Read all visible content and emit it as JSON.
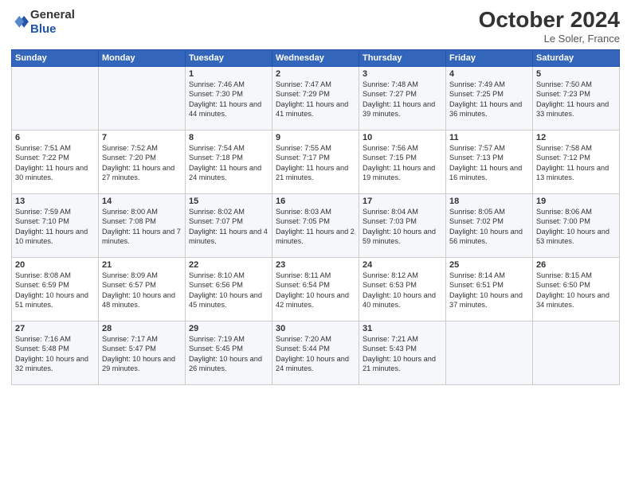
{
  "header": {
    "logo_line1": "General",
    "logo_line2": "Blue",
    "month": "October 2024",
    "location": "Le Soler, France"
  },
  "weekdays": [
    "Sunday",
    "Monday",
    "Tuesday",
    "Wednesday",
    "Thursday",
    "Friday",
    "Saturday"
  ],
  "weeks": [
    [
      {
        "day": "",
        "content": ""
      },
      {
        "day": "",
        "content": ""
      },
      {
        "day": "1",
        "content": "Sunrise: 7:46 AM\nSunset: 7:30 PM\nDaylight: 11 hours and 44 minutes."
      },
      {
        "day": "2",
        "content": "Sunrise: 7:47 AM\nSunset: 7:29 PM\nDaylight: 11 hours and 41 minutes."
      },
      {
        "day": "3",
        "content": "Sunrise: 7:48 AM\nSunset: 7:27 PM\nDaylight: 11 hours and 39 minutes."
      },
      {
        "day": "4",
        "content": "Sunrise: 7:49 AM\nSunset: 7:25 PM\nDaylight: 11 hours and 36 minutes."
      },
      {
        "day": "5",
        "content": "Sunrise: 7:50 AM\nSunset: 7:23 PM\nDaylight: 11 hours and 33 minutes."
      }
    ],
    [
      {
        "day": "6",
        "content": "Sunrise: 7:51 AM\nSunset: 7:22 PM\nDaylight: 11 hours and 30 minutes."
      },
      {
        "day": "7",
        "content": "Sunrise: 7:52 AM\nSunset: 7:20 PM\nDaylight: 11 hours and 27 minutes."
      },
      {
        "day": "8",
        "content": "Sunrise: 7:54 AM\nSunset: 7:18 PM\nDaylight: 11 hours and 24 minutes."
      },
      {
        "day": "9",
        "content": "Sunrise: 7:55 AM\nSunset: 7:17 PM\nDaylight: 11 hours and 21 minutes."
      },
      {
        "day": "10",
        "content": "Sunrise: 7:56 AM\nSunset: 7:15 PM\nDaylight: 11 hours and 19 minutes."
      },
      {
        "day": "11",
        "content": "Sunrise: 7:57 AM\nSunset: 7:13 PM\nDaylight: 11 hours and 16 minutes."
      },
      {
        "day": "12",
        "content": "Sunrise: 7:58 AM\nSunset: 7:12 PM\nDaylight: 11 hours and 13 minutes."
      }
    ],
    [
      {
        "day": "13",
        "content": "Sunrise: 7:59 AM\nSunset: 7:10 PM\nDaylight: 11 hours and 10 minutes."
      },
      {
        "day": "14",
        "content": "Sunrise: 8:00 AM\nSunset: 7:08 PM\nDaylight: 11 hours and 7 minutes."
      },
      {
        "day": "15",
        "content": "Sunrise: 8:02 AM\nSunset: 7:07 PM\nDaylight: 11 hours and 4 minutes."
      },
      {
        "day": "16",
        "content": "Sunrise: 8:03 AM\nSunset: 7:05 PM\nDaylight: 11 hours and 2 minutes."
      },
      {
        "day": "17",
        "content": "Sunrise: 8:04 AM\nSunset: 7:03 PM\nDaylight: 10 hours and 59 minutes."
      },
      {
        "day": "18",
        "content": "Sunrise: 8:05 AM\nSunset: 7:02 PM\nDaylight: 10 hours and 56 minutes."
      },
      {
        "day": "19",
        "content": "Sunrise: 8:06 AM\nSunset: 7:00 PM\nDaylight: 10 hours and 53 minutes."
      }
    ],
    [
      {
        "day": "20",
        "content": "Sunrise: 8:08 AM\nSunset: 6:59 PM\nDaylight: 10 hours and 51 minutes."
      },
      {
        "day": "21",
        "content": "Sunrise: 8:09 AM\nSunset: 6:57 PM\nDaylight: 10 hours and 48 minutes."
      },
      {
        "day": "22",
        "content": "Sunrise: 8:10 AM\nSunset: 6:56 PM\nDaylight: 10 hours and 45 minutes."
      },
      {
        "day": "23",
        "content": "Sunrise: 8:11 AM\nSunset: 6:54 PM\nDaylight: 10 hours and 42 minutes."
      },
      {
        "day": "24",
        "content": "Sunrise: 8:12 AM\nSunset: 6:53 PM\nDaylight: 10 hours and 40 minutes."
      },
      {
        "day": "25",
        "content": "Sunrise: 8:14 AM\nSunset: 6:51 PM\nDaylight: 10 hours and 37 minutes."
      },
      {
        "day": "26",
        "content": "Sunrise: 8:15 AM\nSunset: 6:50 PM\nDaylight: 10 hours and 34 minutes."
      }
    ],
    [
      {
        "day": "27",
        "content": "Sunrise: 7:16 AM\nSunset: 5:48 PM\nDaylight: 10 hours and 32 minutes."
      },
      {
        "day": "28",
        "content": "Sunrise: 7:17 AM\nSunset: 5:47 PM\nDaylight: 10 hours and 29 minutes."
      },
      {
        "day": "29",
        "content": "Sunrise: 7:19 AM\nSunset: 5:45 PM\nDaylight: 10 hours and 26 minutes."
      },
      {
        "day": "30",
        "content": "Sunrise: 7:20 AM\nSunset: 5:44 PM\nDaylight: 10 hours and 24 minutes."
      },
      {
        "day": "31",
        "content": "Sunrise: 7:21 AM\nSunset: 5:43 PM\nDaylight: 10 hours and 21 minutes."
      },
      {
        "day": "",
        "content": ""
      },
      {
        "day": "",
        "content": ""
      }
    ]
  ]
}
